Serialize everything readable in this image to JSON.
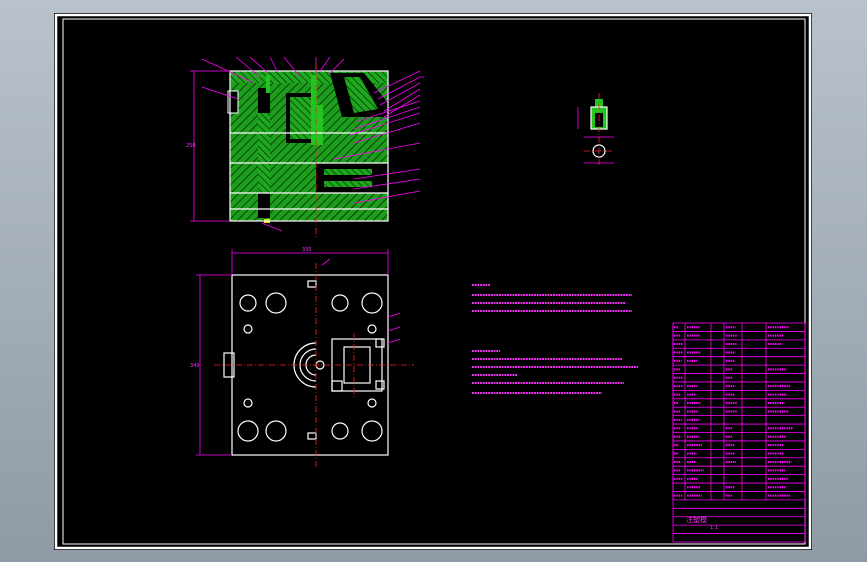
{
  "drawing": {
    "dimension_labels": [
      "335",
      "250",
      "340"
    ]
  },
  "title_block": {
    "name": "注塑模",
    "scale": "1:1"
  },
  "colors": {
    "background": "#000000",
    "frame": "#ffffff",
    "annotation": "#ff00ff",
    "solid_part": "#22c422",
    "center_line": "#ff2020",
    "highlight": "#e0e000"
  }
}
